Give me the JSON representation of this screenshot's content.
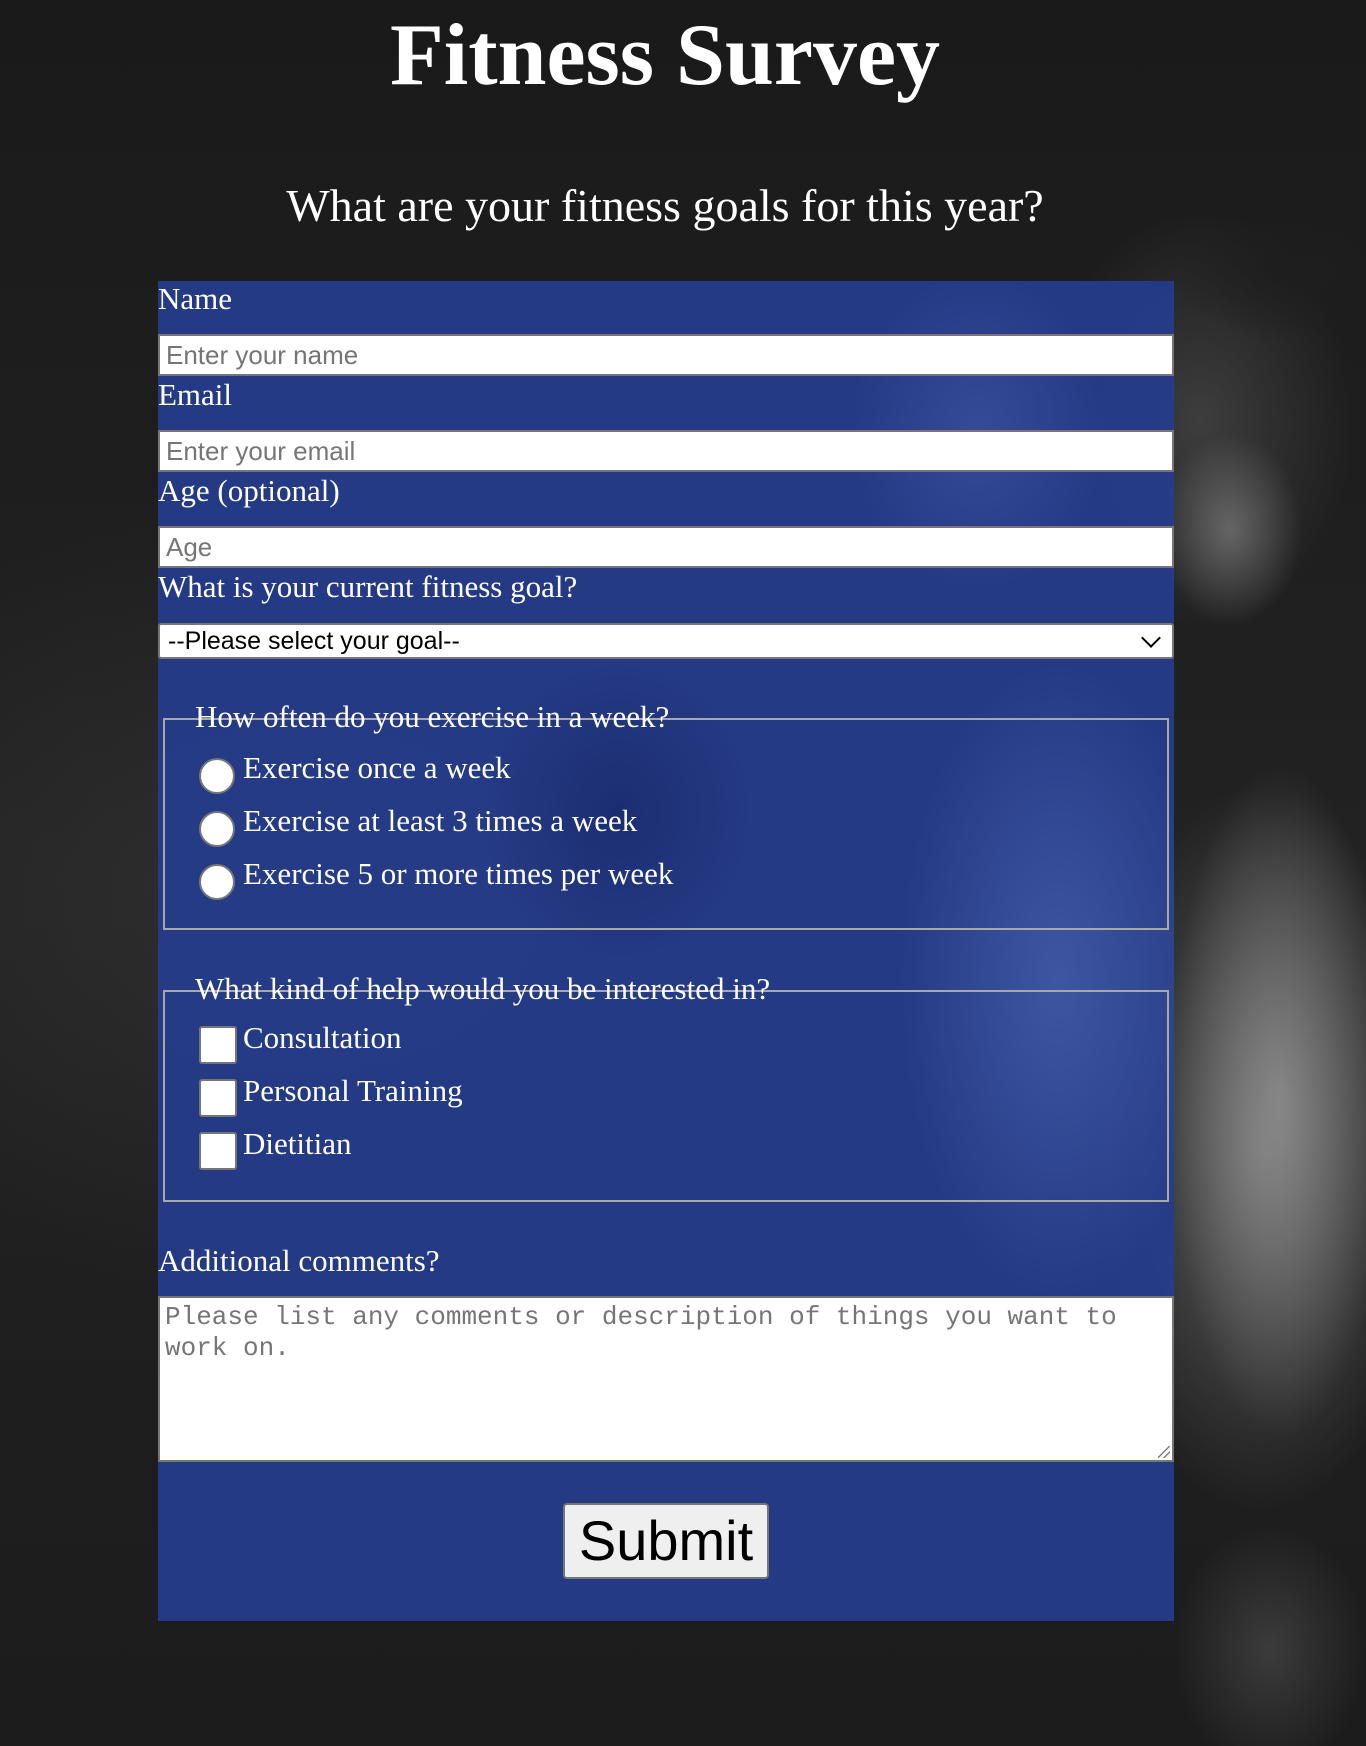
{
  "header": {
    "title": "Fitness Survey",
    "description": "What are your fitness goals for this year?"
  },
  "form": {
    "name": {
      "label": "Name",
      "placeholder": "Enter your name",
      "value": ""
    },
    "email": {
      "label": "Email",
      "placeholder": "Enter your email",
      "value": ""
    },
    "age": {
      "label": "Age (optional)",
      "placeholder": "Age",
      "value": ""
    },
    "goal": {
      "label": "What is your current fitness goal?",
      "selected": "--Please select your goal--",
      "icon": "chevron-down-icon"
    },
    "frequency": {
      "legend": "How often do you exercise in a week?",
      "options": [
        {
          "label": "Exercise once a week",
          "checked": false
        },
        {
          "label": "Exercise at least 3 times a week",
          "checked": false
        },
        {
          "label": "Exercise 5 or more times per week",
          "checked": false
        }
      ]
    },
    "help": {
      "legend": "What kind of help would you be interested in?",
      "options": [
        {
          "label": "Consultation",
          "checked": false
        },
        {
          "label": "Personal Training",
          "checked": false
        },
        {
          "label": "Dietitian",
          "checked": false
        }
      ]
    },
    "comments": {
      "label": "Additional comments?",
      "placeholder": "Please list any comments or description of things you want to work on.",
      "value": ""
    },
    "submit_label": "Submit"
  },
  "colors": {
    "form_background": "#263c8c",
    "page_background": "#1c1c1c",
    "text": "#ffffff"
  }
}
